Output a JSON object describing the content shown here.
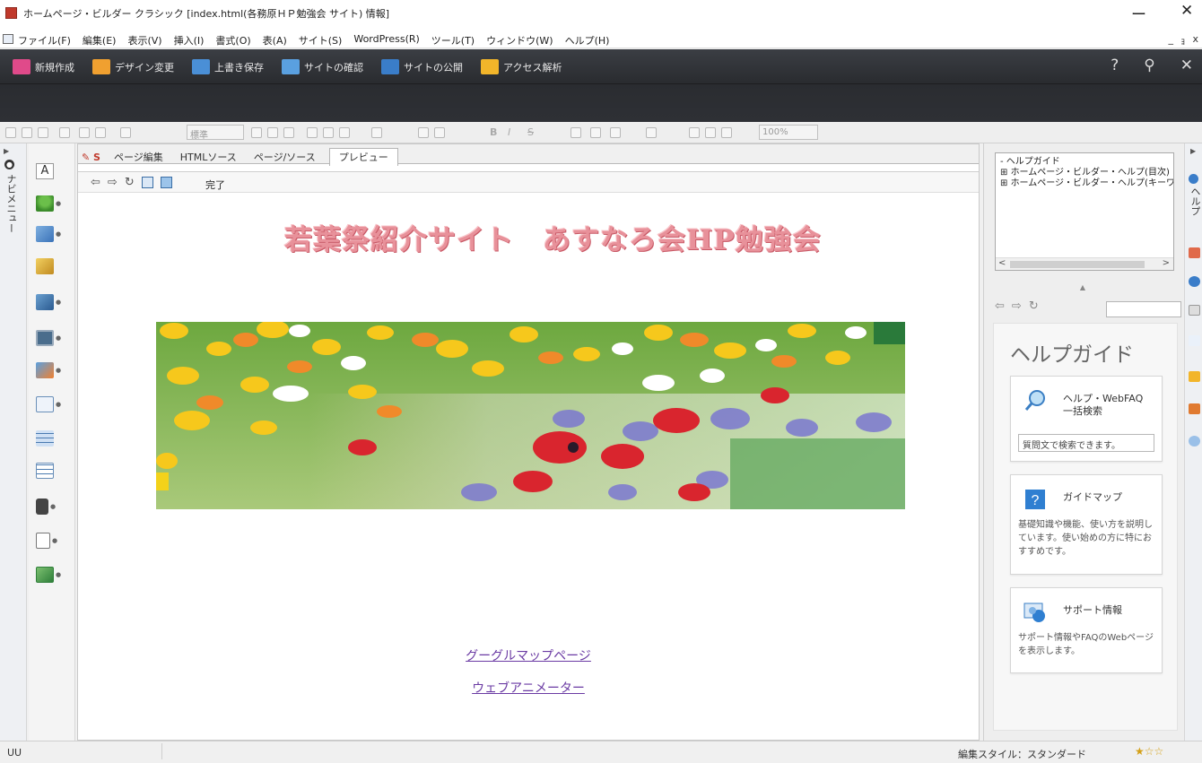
{
  "window": {
    "title": "ホームページ・ビルダー クラシック [index.html(各務原ＨＰ勉強会 サイト) 情報]",
    "minimize": "ー",
    "close": "✕"
  },
  "menubar": {
    "items": [
      "ファイル(F)",
      "編集(E)",
      "表示(V)",
      "挿入(I)",
      "書式(O)",
      "表(A)",
      "サイト(S)",
      "WordPress(R)",
      "ツール(T)",
      "ウィンドウ(W)",
      "ヘルプ(H)"
    ],
    "mdi_buttons": [
      "_",
      "ｮ",
      "x"
    ]
  },
  "toolbar": {
    "buttons": [
      {
        "label": "新規作成",
        "icon": "new-page-icon",
        "color": "#e04a8a"
      },
      {
        "label": "デザイン変更",
        "icon": "design-change-icon",
        "color": "#f0a030"
      },
      {
        "label": "上書き保存",
        "icon": "save-icon",
        "color": "#4a8fd6"
      },
      {
        "label": "サイトの確認",
        "icon": "site-check-icon",
        "color": "#5aa0e0"
      },
      {
        "label": "サイトの公開",
        "icon": "site-publish-icon",
        "color": "#3a7dc9"
      },
      {
        "label": "アクセス解析",
        "icon": "access-analytics-icon",
        "color": "#f2b52a"
      }
    ],
    "right_icons": [
      "?",
      "⚲",
      "✕"
    ]
  },
  "format_bar": {
    "style_value": "標準",
    "zoom_value": "100%",
    "bold": "B",
    "italic": "I",
    "strike": "S"
  },
  "left_panel": {
    "vertical_label": "ナビメニュー",
    "palette_first": "A"
  },
  "editor": {
    "tabs": [
      "ページ編集",
      "HTMLソース",
      "ページ/ソース",
      "プレビュー"
    ],
    "active_tab": "プレビュー",
    "status": "完了",
    "page_title": "若葉祭紹介サイト　あすなろ会HP勉強会",
    "links": [
      "グーグルマップページ",
      "ウェブアニメーター"
    ]
  },
  "help_panel": {
    "tree": [
      "ヘルプガイド",
      "ホームページ・ビルダー・ヘルプ(目次)",
      "ホームページ・ビルダー・ヘルプ(キーワード)"
    ],
    "heading": "ヘルプガイド",
    "cards": [
      {
        "title": "ヘルプ・WebFAQ\n一括検索",
        "input": "質問文で検索できます。",
        "icon": "search-icon"
      },
      {
        "title": "ガイドマップ",
        "desc": "基礎知識や機能、使い方を説明しています。使い始めの方に特におすすめです。",
        "icon": "help-question-icon"
      },
      {
        "title": "サポート情報",
        "desc": "サポート情報やFAQのWebページを表示します。",
        "icon": "support-icon"
      }
    ],
    "right_label": "ヘルプ"
  },
  "statusbar": {
    "left": "UU",
    "style": "編集スタイル：スタンダード",
    "stars": "★☆☆"
  },
  "colors": {
    "dark_toolbar": "#2e3035",
    "title_pink": "#e8919a",
    "link_purple": "#6a3aa3"
  }
}
